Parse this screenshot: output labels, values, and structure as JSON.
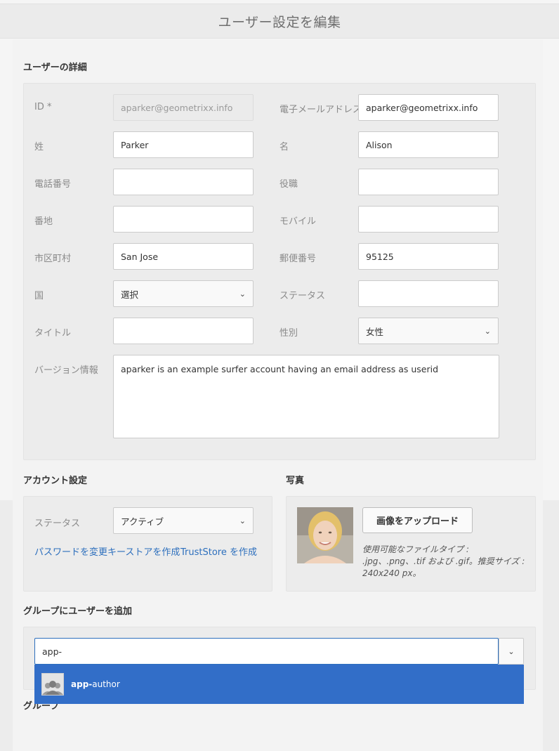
{
  "header": {
    "title": "ユーザー設定を編集"
  },
  "user_details": {
    "heading": "ユーザーの詳細",
    "fields": {
      "id": {
        "label": "ID *",
        "value": "aparker@geometrixx.info"
      },
      "email": {
        "label": "電子メールアドレス",
        "value": "aparker@geometrixx.info"
      },
      "last_name": {
        "label": "姓",
        "value": "Parker"
      },
      "first_name": {
        "label": "名",
        "value": "Alison"
      },
      "phone": {
        "label": "電話番号",
        "value": ""
      },
      "job_title": {
        "label": "役職",
        "value": ""
      },
      "street": {
        "label": "番地",
        "value": ""
      },
      "mobile": {
        "label": "モバイル",
        "value": ""
      },
      "city": {
        "label": "市区町村",
        "value": "San Jose"
      },
      "postal_code": {
        "label": "郵便番号",
        "value": "95125"
      },
      "country": {
        "label": "国",
        "value": "選択"
      },
      "state": {
        "label": "ステータス",
        "value": ""
      },
      "title": {
        "label": "タイトル",
        "value": ""
      },
      "gender": {
        "label": "性別",
        "value": "女性"
      },
      "about": {
        "label": "バージョン情報",
        "value": "aparker is an example surfer account having an email address as userid"
      }
    }
  },
  "account_settings": {
    "heading": "アカウント設定",
    "status_label": "ステータス",
    "status_value": "アクティブ",
    "links": {
      "change_password": "パスワードを変更",
      "create_keystore": "キーストアを作成",
      "create_truststore": "TrustStore を作成"
    }
  },
  "photo": {
    "heading": "写真",
    "upload_label": "画像をアップロード",
    "hint": "使用可能なファイルタイプ : .jpg、.png、.tif および .gif。推奨サイズ : 240x240 px。"
  },
  "groups": {
    "heading": "グループにユーザーを追加",
    "search_value": "app-",
    "suggestion_match": "app-",
    "suggestion_rest": "author",
    "groups_label": "グループ"
  },
  "icons": {
    "chevron": "chevron-down-icon",
    "avatar": "group-avatar-icon"
  },
  "colors": {
    "accent": "#326ec8",
    "link": "#2d6fbd"
  }
}
